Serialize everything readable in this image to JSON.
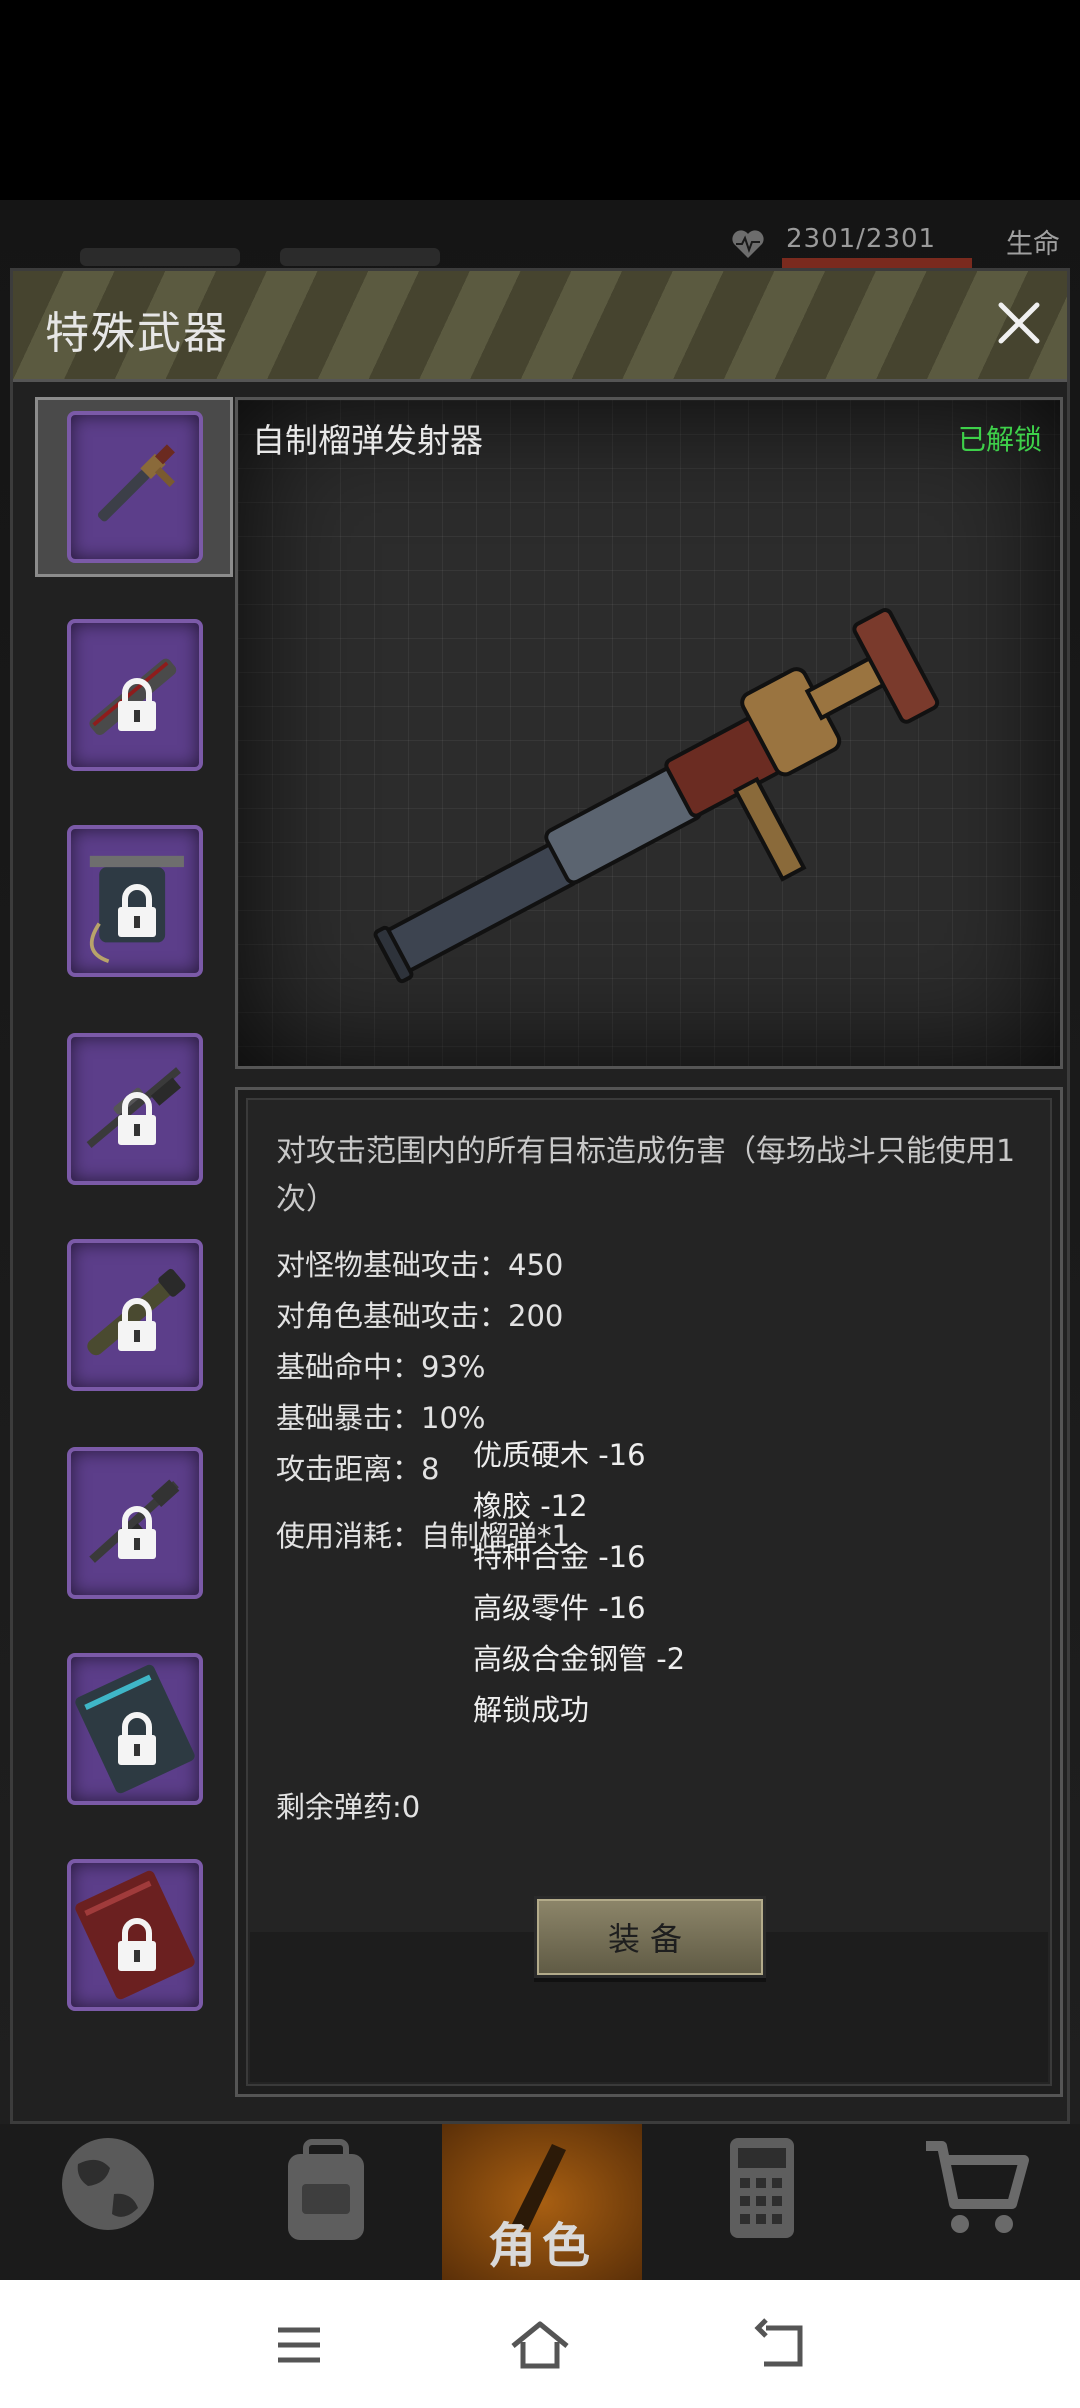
{
  "hud": {
    "hp_text": "2301/2301",
    "life_label": "生命"
  },
  "modal": {
    "title": "特殊武器",
    "close_icon": "close-icon"
  },
  "sidebar": {
    "items": [
      {
        "weapon": "grenade-launcher",
        "locked": false,
        "selected": true
      },
      {
        "weapon": "chainsaw",
        "locked": true
      },
      {
        "weapon": "flamethrower",
        "locked": true
      },
      {
        "weapon": "sniper-rifle",
        "locked": true
      },
      {
        "weapon": "rocket-launcher",
        "locked": true
      },
      {
        "weapon": "assault-rifle",
        "locked": true
      },
      {
        "weapon": "tech-case",
        "locked": true
      },
      {
        "weapon": "red-case",
        "locked": true
      }
    ]
  },
  "preview": {
    "weapon_name": "自制榴弹发射器",
    "status": "已解锁",
    "status_color": "#3ed04a"
  },
  "info": {
    "description": "对攻击范围内的所有目标造成伤害（每场战斗只能使用1次）",
    "stats": [
      "对怪物基础攻击：450",
      "对角色基础攻击：200",
      "基础命中：93%",
      "基础暴击：10%",
      "攻击距离：8"
    ],
    "consume": "使用消耗：自制榴弹*1",
    "toast": [
      "优质硬木 -16",
      "橡胶 -12",
      "特种合金 -16",
      "高级零件 -16",
      "高级合金钢管 -2",
      "解锁成功"
    ],
    "ammo": "剩余弹药:0",
    "equip_label": "装备"
  },
  "game_nav": {
    "items": [
      {
        "icon": "globe-icon"
      },
      {
        "icon": "backpack-icon"
      },
      {
        "icon": "character-icon",
        "label": "角色",
        "active": true
      },
      {
        "icon": "calculator-icon"
      },
      {
        "icon": "cart-icon"
      }
    ]
  },
  "system_nav": {
    "menu_icon": "menu-icon",
    "home_icon": "home-icon",
    "back_icon": "back-icon"
  }
}
